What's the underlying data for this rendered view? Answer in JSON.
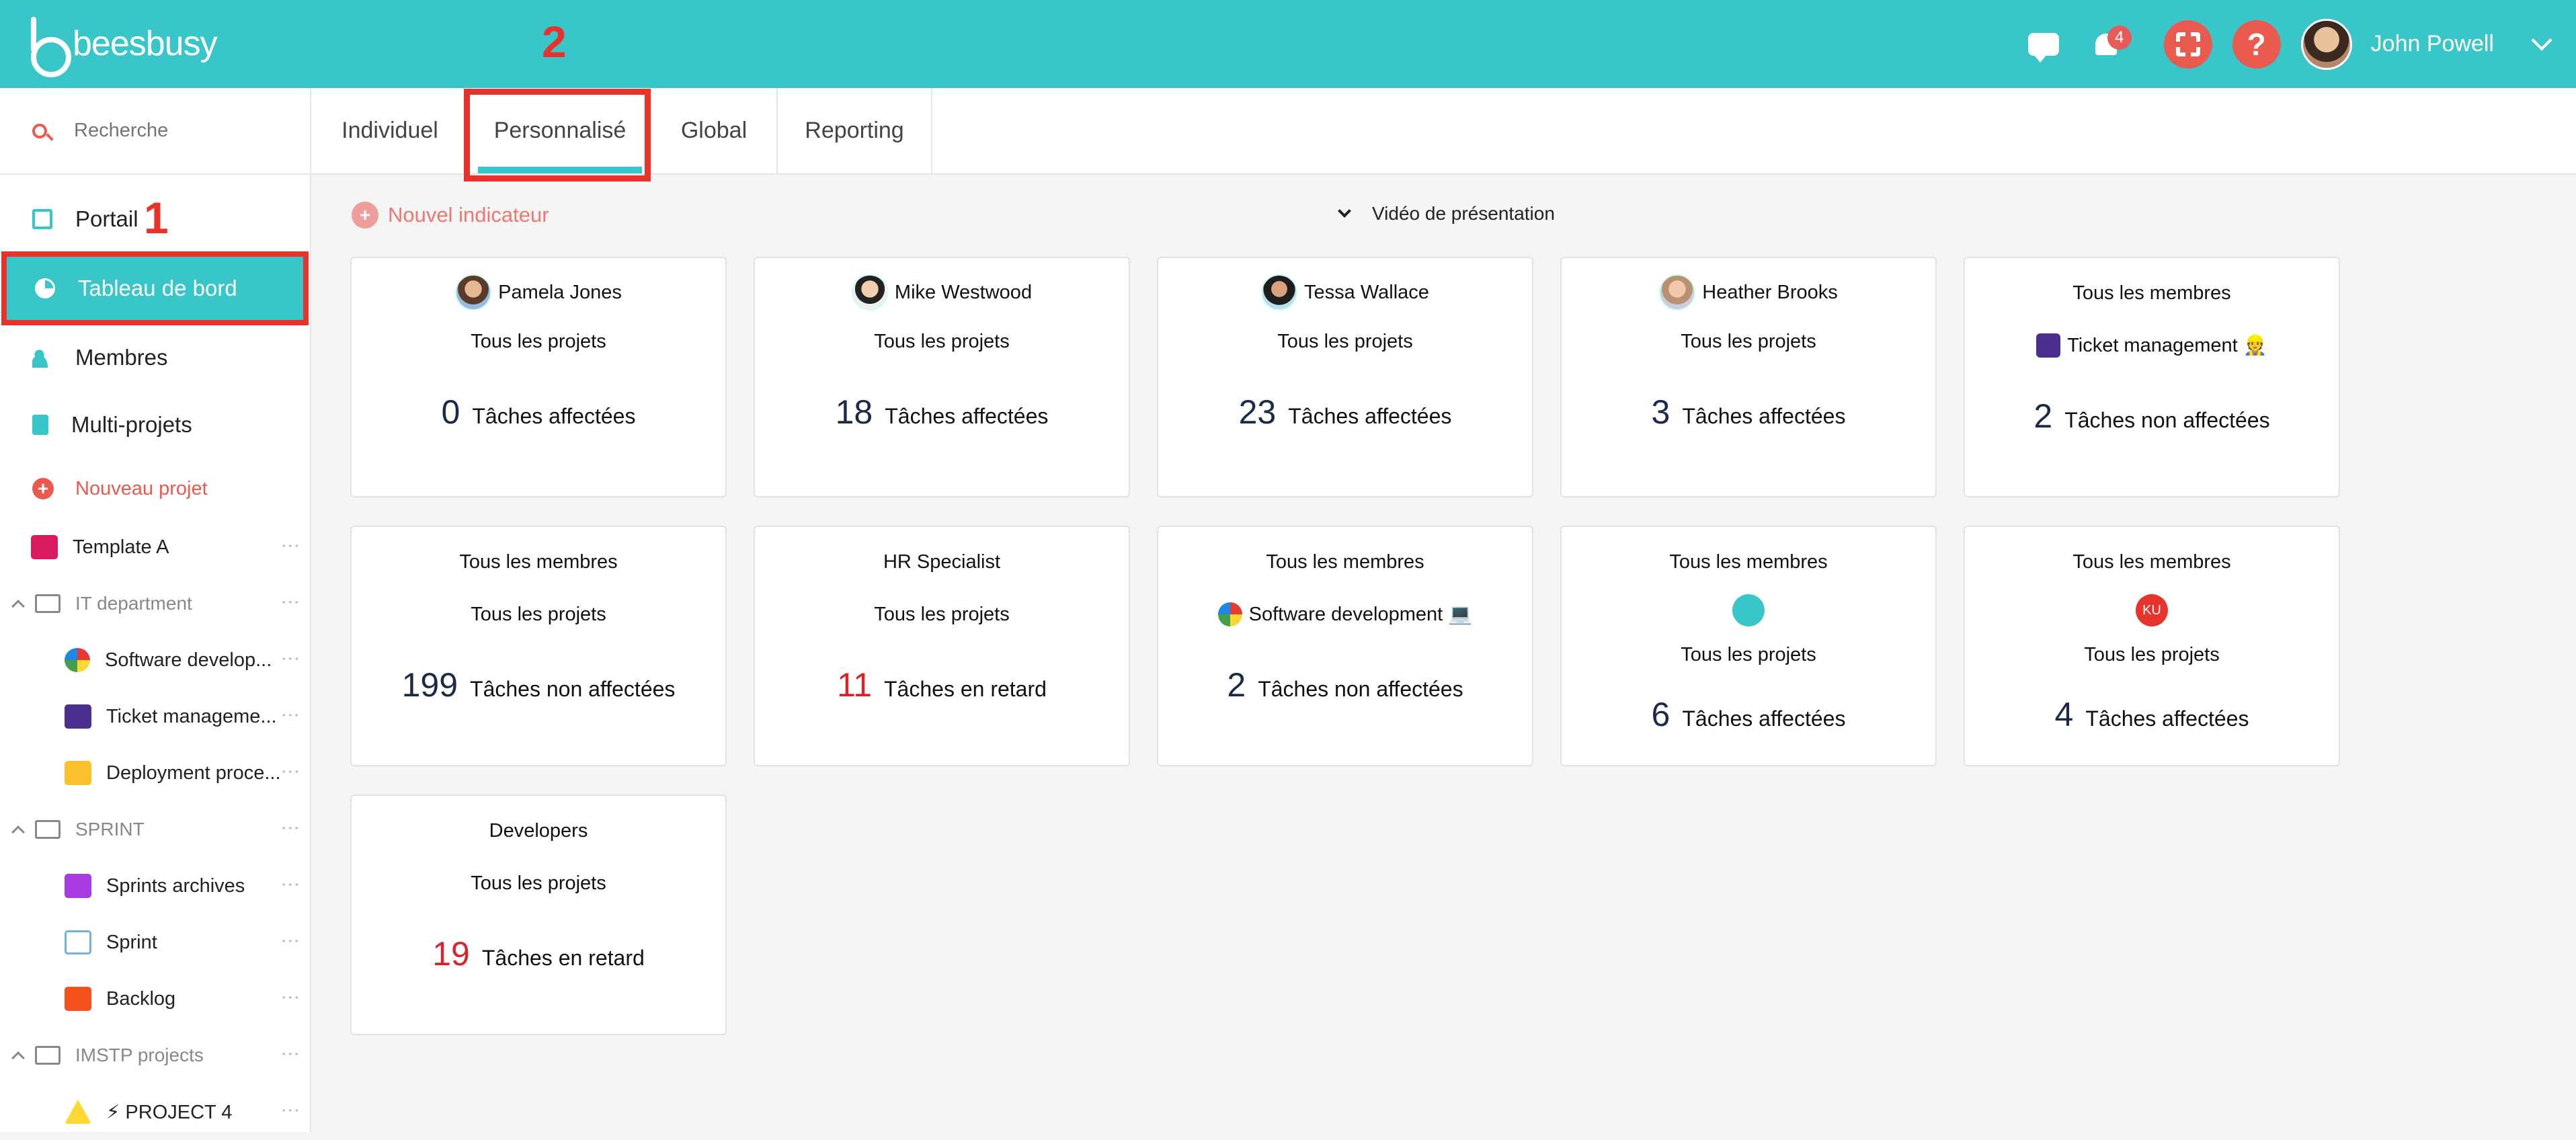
{
  "topbar": {
    "logo_text": "beesbusy",
    "notifications_count": "4",
    "help_label": "?",
    "user_name": "John Powell"
  },
  "sidebar": {
    "search_placeholder": "Recherche",
    "nav": [
      {
        "label": "Portail"
      },
      {
        "label": "Tableau de bord"
      },
      {
        "label": "Membres"
      },
      {
        "label": "Multi-projets"
      }
    ],
    "new_project": "Nouveau projet",
    "annotations": {
      "one": "1",
      "two": "2"
    },
    "projects": {
      "template": "Template A",
      "folder1": "IT department",
      "folder1_items": [
        "Software develop...",
        "Ticket manageme...",
        "Deployment proce..."
      ],
      "folder2": "SPRINT",
      "folder2_items": [
        "Sprints archives",
        "Sprint",
        "Backlog"
      ],
      "folder3": "IMSTP projects",
      "folder3_items": [
        "⚡ PROJECT 4"
      ]
    }
  },
  "tabs": [
    "Individuel",
    "Personnalisé",
    "Global",
    "Reporting"
  ],
  "main": {
    "new_indicator": "Nouvel indicateur",
    "video": "Vidéo de présentation"
  },
  "cards": [
    {
      "owner": "Pamela Jones",
      "project": "Tous les projets",
      "value": "0",
      "label": "Tâches affectées"
    },
    {
      "owner": "Mike Westwood",
      "project": "Tous les projets",
      "value": "18",
      "label": "Tâches affectées"
    },
    {
      "owner": "Tessa Wallace",
      "project": "Tous les projets",
      "value": "23",
      "label": "Tâches affectées"
    },
    {
      "owner": "Heather Brooks",
      "project": "Tous les projets",
      "value": "3",
      "label": "Tâches affectées"
    },
    {
      "owner": "Tous les membres",
      "project": "Ticket management 👷",
      "value": "2",
      "label": "Tâches non affectées"
    },
    {
      "owner": "Tous les membres",
      "project": "Tous les projets",
      "value": "199",
      "label": "Tâches non affectées"
    },
    {
      "owner": "HR Specialist",
      "project": "Tous les projets",
      "value": "11",
      "label": "Tâches en retard"
    },
    {
      "owner": "Tous les membres",
      "project": "Software development 💻",
      "value": "2",
      "label": "Tâches non affectées"
    },
    {
      "owner": "Tous les membres",
      "team_badge": "",
      "project": "Tous les projets",
      "value": "6",
      "label": "Tâches affectées"
    },
    {
      "owner": "Tous les membres",
      "team_badge": "KU",
      "project": "Tous les projets",
      "value": "4",
      "label": "Tâches affectées"
    },
    {
      "owner": "Developers",
      "project": "Tous les projets",
      "value": "19",
      "label": "Tâches en retard"
    }
  ],
  "colors": {
    "brand": "#38c6c9",
    "accent": "#ea5a4f",
    "late": "#d8232a",
    "annotation": "#e8322c"
  }
}
